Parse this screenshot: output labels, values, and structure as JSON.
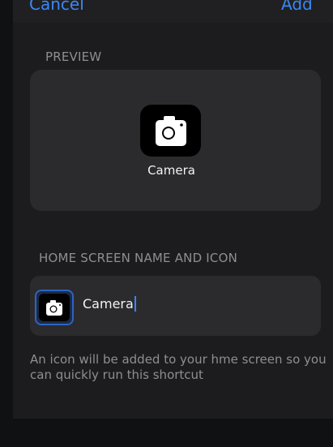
{
  "nav": {
    "cancel_label": "Cancel",
    "add_label": "Add"
  },
  "preview": {
    "section_label": "PREVIEW",
    "shortcut_name": "Camera",
    "icon": "camera-icon"
  },
  "home_screen": {
    "section_label": "HOME SCREEN NAME AND ICON",
    "name_value": "Camera",
    "icon": "camera-icon"
  },
  "footnote": {
    "line1": "An icon will be added to your hme screen so you",
    "line2": "can quickly run this shortcut"
  },
  "colors": {
    "accent": "#3b87f5",
    "sheet": "#1c1c1e",
    "card": "#2b2b2e",
    "secondary_text": "#8e8e93"
  }
}
